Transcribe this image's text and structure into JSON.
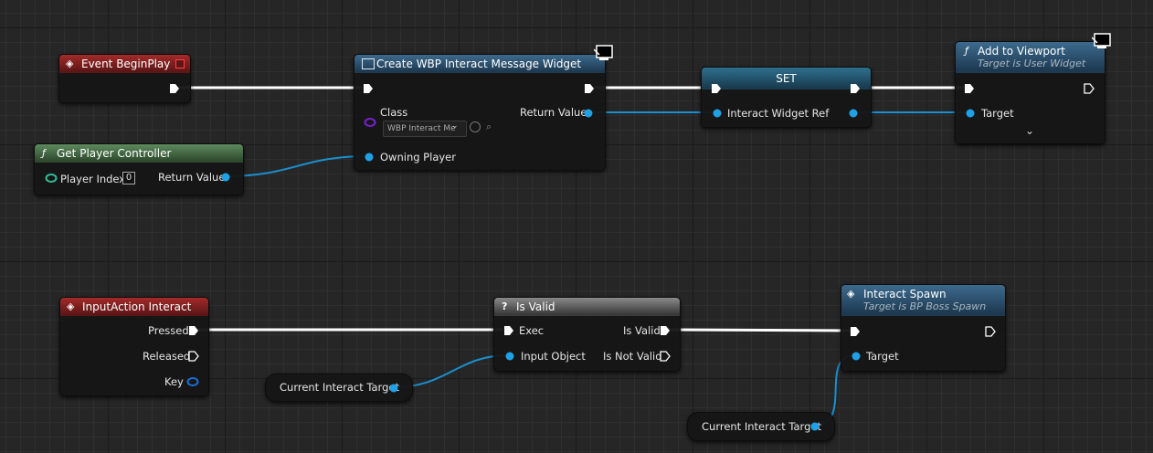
{
  "nodes": {
    "begin_play": {
      "title": "Event BeginPlay"
    },
    "get_player_controller": {
      "title": "Get Player Controller",
      "player_index_label": "Player Index",
      "player_index_value": "0",
      "return_label": "Return Value"
    },
    "create_widget": {
      "title": "Create WBP Interact Message Widget",
      "class_label": "Class",
      "class_value": "WBP Interact Me",
      "return_label": "Return Value",
      "owning_label": "Owning Player"
    },
    "set": {
      "title": "SET",
      "var_label": "Interact Widget Ref"
    },
    "add_viewport": {
      "title": "Add to Viewport",
      "subtitle": "Target is User Widget",
      "target_label": "Target"
    },
    "input_action": {
      "title": "InputAction Interact",
      "pressed_label": "Pressed",
      "released_label": "Released",
      "key_label": "Key"
    },
    "is_valid": {
      "title": "Is Valid",
      "exec_label": "Exec",
      "input_label": "Input Object",
      "valid_label": "Is Valid",
      "not_valid_label": "Is Not Valid"
    },
    "interact_spawn": {
      "title": "Interact Spawn",
      "subtitle": "Target is BP Boss Spawn",
      "target_label": "Target"
    },
    "var_target_1": {
      "label": "Current Interact Target"
    },
    "var_target_2": {
      "label": "Current Interact Target"
    }
  },
  "colors": {
    "exec": "#ffffff",
    "object": "#1ea1e6",
    "struct": "#2fbf9a",
    "class": "#7a1fd1",
    "wire_object": "#1a8fce"
  }
}
